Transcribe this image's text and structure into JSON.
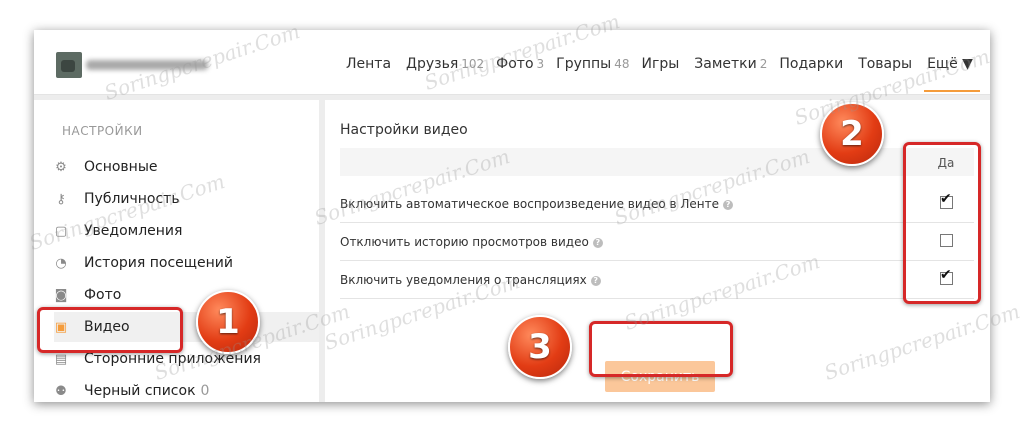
{
  "nav": [
    {
      "label": "Лента",
      "count": ""
    },
    {
      "label": "Друзья",
      "count": "102"
    },
    {
      "label": "Фото",
      "count": "3"
    },
    {
      "label": "Группы",
      "count": "48"
    },
    {
      "label": "Игры",
      "count": ""
    },
    {
      "label": "Заметки",
      "count": "2"
    },
    {
      "label": "Подарки",
      "count": ""
    },
    {
      "label": "Товары",
      "count": ""
    }
  ],
  "nav_more": "Ещё ▼",
  "sidebar": {
    "heading": "НАСТРОЙКИ",
    "items": [
      {
        "label": "Основные",
        "icon": "gear-icon",
        "glyph": "⚙",
        "active": false
      },
      {
        "label": "Публичность",
        "icon": "key-icon",
        "glyph": "⚷",
        "active": false
      },
      {
        "label": "Уведомления",
        "icon": "notification-icon",
        "glyph": "▢",
        "active": false
      },
      {
        "label": "История посещений",
        "icon": "history-icon",
        "glyph": "◔",
        "active": false
      },
      {
        "label": "Фото",
        "icon": "camera-icon",
        "glyph": "◙",
        "active": false
      },
      {
        "label": "Видео",
        "icon": "video-icon",
        "glyph": "▣",
        "active": true
      },
      {
        "label": "Сторонние приложения",
        "icon": "apps-icon",
        "glyph": "▤",
        "active": false
      },
      {
        "label": "Черный список",
        "count": "0",
        "icon": "blocked-user-icon",
        "glyph": "⚉",
        "active": false
      }
    ]
  },
  "content": {
    "title": "Настройки видео",
    "column_label": "Да",
    "help_glyph": "?",
    "check_glyph": "✔",
    "rows": [
      {
        "label": "Включить автоматическое воспроизведение видео в Ленте",
        "checked": true
      },
      {
        "label": "Отключить историю просмотров видео",
        "checked": false
      },
      {
        "label": "Включить уведомления о трансляциях",
        "checked": true
      }
    ],
    "save_label": "Сохранить"
  },
  "badges": [
    "1",
    "2",
    "3"
  ],
  "watermark": "Soringpcrepair.Com",
  "colors": {
    "accent": "#f59c3b",
    "save_button": "#fbc79a",
    "highlight": "#d62828",
    "badge": "#e23c14"
  }
}
